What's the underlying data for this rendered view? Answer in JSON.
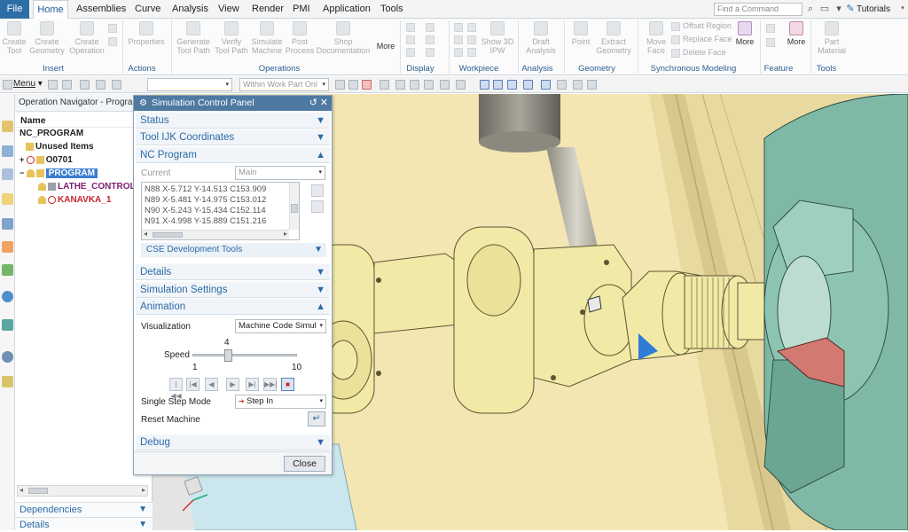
{
  "tabs": {
    "file": "File",
    "items": [
      "Home",
      "Assemblies",
      "Curve",
      "Analysis",
      "View",
      "Render",
      "PMI",
      "Application",
      "Tools"
    ],
    "active": "Home"
  },
  "search": {
    "placeholder": "Find a Command"
  },
  "help": {
    "tutorials": "Tutorials"
  },
  "ribbon": {
    "buttons": [
      {
        "label": "Create\nTool"
      },
      {
        "label": "Create\nGeometry"
      },
      {
        "label": "Create\nOperation"
      },
      {
        "label": "Properties"
      },
      {
        "label": "Generate\nTool Path"
      },
      {
        "label": "Verify\nTool Path"
      },
      {
        "label": "Simulate\nMachine"
      },
      {
        "label": "Post\nProcess"
      },
      {
        "label": "Shop\nDocumentation"
      },
      {
        "label": "More"
      },
      {
        "label": "Show 3D\nIPW"
      },
      {
        "label": "Draft\nAnalysis"
      },
      {
        "label": "Point"
      },
      {
        "label": "Extract\nGeometry"
      },
      {
        "label": "Move\nFace"
      },
      {
        "label": "More"
      },
      {
        "label": "More"
      },
      {
        "label": "Part\nMaterial"
      }
    ],
    "sync_items": [
      "Offset Region",
      "Replace Face",
      "Delete Face"
    ],
    "groups": [
      "Insert",
      "Actions",
      "Operations",
      "Display",
      "Workpiece",
      "Analysis",
      "Geometry",
      "Synchronous Modeling",
      "Feature",
      "Tools"
    ]
  },
  "toolbar": {
    "menu": "Menu",
    "combo1": "",
    "combo2": "Within Work Part Onl"
  },
  "navigator": {
    "title": "Operation Navigator - Progra...",
    "column": "Name",
    "rows": [
      {
        "label": "NC_PROGRAM"
      },
      {
        "label": "Unused Items"
      },
      {
        "label": "O0701"
      },
      {
        "label": "PROGRAM"
      },
      {
        "label": "LATHE_CONTROL"
      },
      {
        "label": "KANAVKA_1"
      }
    ],
    "footers": [
      "Dependencies",
      "Details"
    ]
  },
  "panel": {
    "title": "Simulation Control Panel",
    "sections": {
      "status": "Status",
      "tool_ijk": "Tool IJK Coordinates",
      "nc_program": "NC Program",
      "details": "Details",
      "sim_settings": "Simulation Settings",
      "animation": "Animation",
      "debug": "Debug"
    },
    "current_label": "Current",
    "current_value": "Main",
    "nc_lines": [
      "N88 X-5.712 Y-14.513 C153.909",
      "N89 X-5.481 Y-14.975 C153.012",
      "N90 X-5.243 Y-15.434 C152.114",
      "N91 X-4.998 Y-15.889 C151.216"
    ],
    "cse_tools": "CSE Development Tools",
    "visualization_label": "Visualization",
    "visualization_value": "Machine Code Simul",
    "speed_label": "Speed",
    "speed_value": "4",
    "speed_min": "1",
    "speed_max": "10",
    "speed_fraction": 0.333,
    "single_step_label": "Single Step Mode",
    "single_step_value": "Step In",
    "reset_label": "Reset Machine",
    "close": "Close"
  },
  "colors": {
    "accent": "#2e6ea6",
    "part": "#f1e9a6",
    "chuck": "#7fb9a6",
    "panel_title": "#4e7aa2"
  }
}
